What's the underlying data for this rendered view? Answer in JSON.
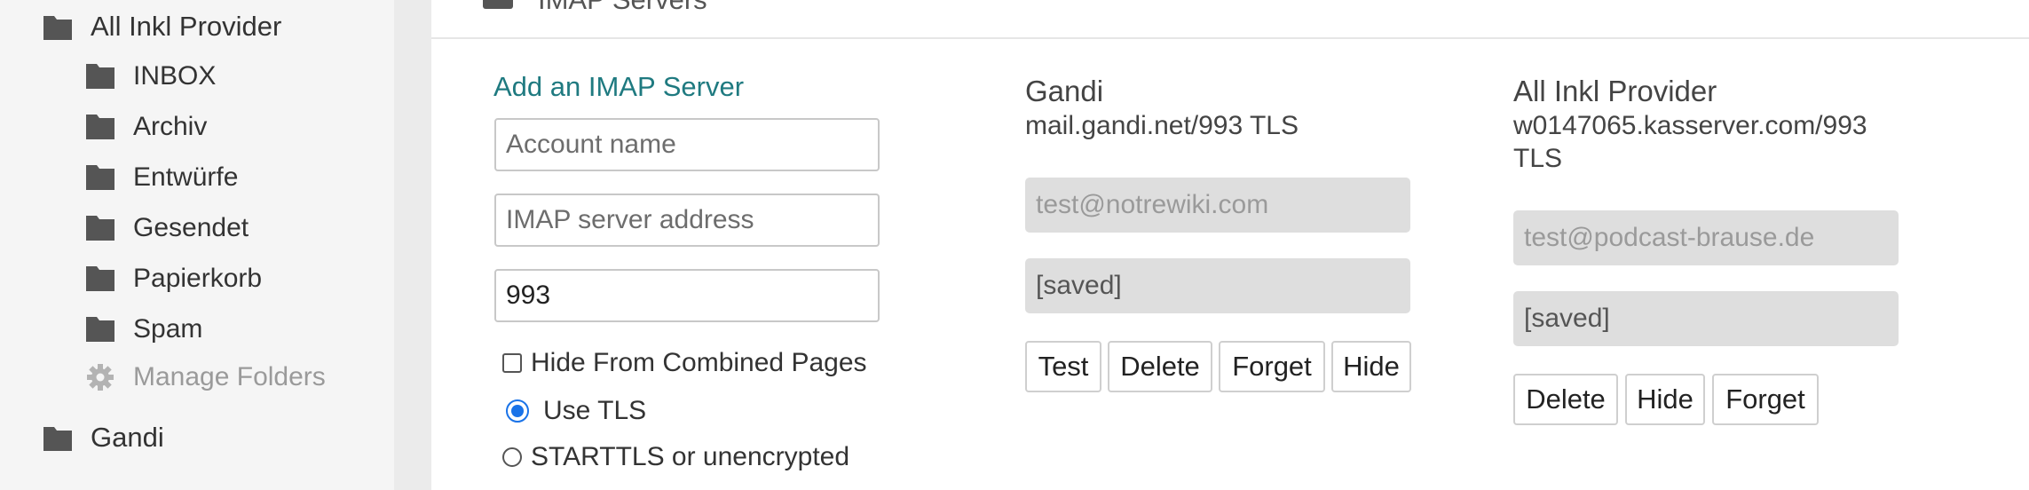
{
  "sidebar": {
    "top_account": "All Inkl Provider",
    "folders": [
      {
        "label": "INBOX"
      },
      {
        "label": "Archiv"
      },
      {
        "label": "Entwürfe"
      },
      {
        "label": "Gesendet"
      },
      {
        "label": "Papierkorb"
      },
      {
        "label": "Spam"
      }
    ],
    "manage_label": "Manage Folders",
    "second_account": "Gandi"
  },
  "section": {
    "title": "IMAP Servers"
  },
  "add_server": {
    "title": "Add an IMAP Server",
    "account_name_placeholder": "Account name",
    "server_address_placeholder": "IMAP server address",
    "port_value": "993",
    "hide_combined_label": "Hide From Combined Pages",
    "hide_combined_checked": false,
    "use_tls_label": "Use TLS",
    "starttls_label": "STARTTLS or unencrypted",
    "selected_security": "Use TLS"
  },
  "accounts": [
    {
      "name": "Gandi",
      "server": "mail.gandi.net/993 TLS",
      "username": "test@notrewiki.com",
      "password": "[saved]",
      "buttons": [
        "Test",
        "Delete",
        "Forget",
        "Hide"
      ]
    },
    {
      "name": "All Inkl Provider",
      "server": "w0147065.kasserver.com/993 TLS",
      "username": "test@podcast-brause.de",
      "password": "[saved]",
      "buttons": [
        "Delete",
        "Hide",
        "Forget"
      ]
    }
  ],
  "colors": {
    "accent_teal": "#1f7a80",
    "radio_blue": "#1a73e8",
    "sidebar_bg": "#f5f5f5",
    "disabled_bg": "#dedede"
  }
}
